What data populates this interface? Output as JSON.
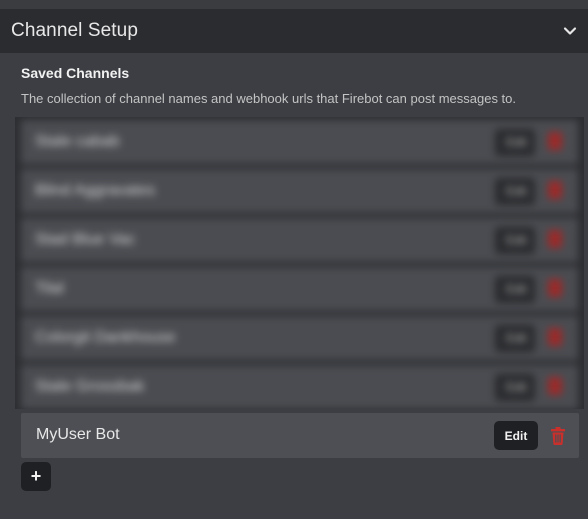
{
  "header": {
    "title": "Channel Setup"
  },
  "section": {
    "title": "Saved Channels",
    "description": "The collection of channel names and webhook urls that Firebot can post messages to."
  },
  "blurred_channels": [
    {
      "name": "Stale cabab",
      "edit_label": "Edit"
    },
    {
      "name": "Blind Aggravates",
      "edit_label": "Edit"
    },
    {
      "name": "Stad Blue Vac",
      "edit_label": "Edit"
    },
    {
      "name": "Tilal",
      "edit_label": "Edit"
    },
    {
      "name": "Colorgit Dankhouse",
      "edit_label": "Edit"
    },
    {
      "name": "Stale Grossbak",
      "edit_label": "Edit"
    }
  ],
  "channel": {
    "name": "MyUser Bot",
    "edit_label": "Edit"
  },
  "add_button": {
    "label": "+"
  },
  "colors": {
    "background": "#3c3e43",
    "header": "#2b2c30",
    "row": "#4d4f54",
    "button": "#1f2023",
    "danger": "#c9302c"
  }
}
